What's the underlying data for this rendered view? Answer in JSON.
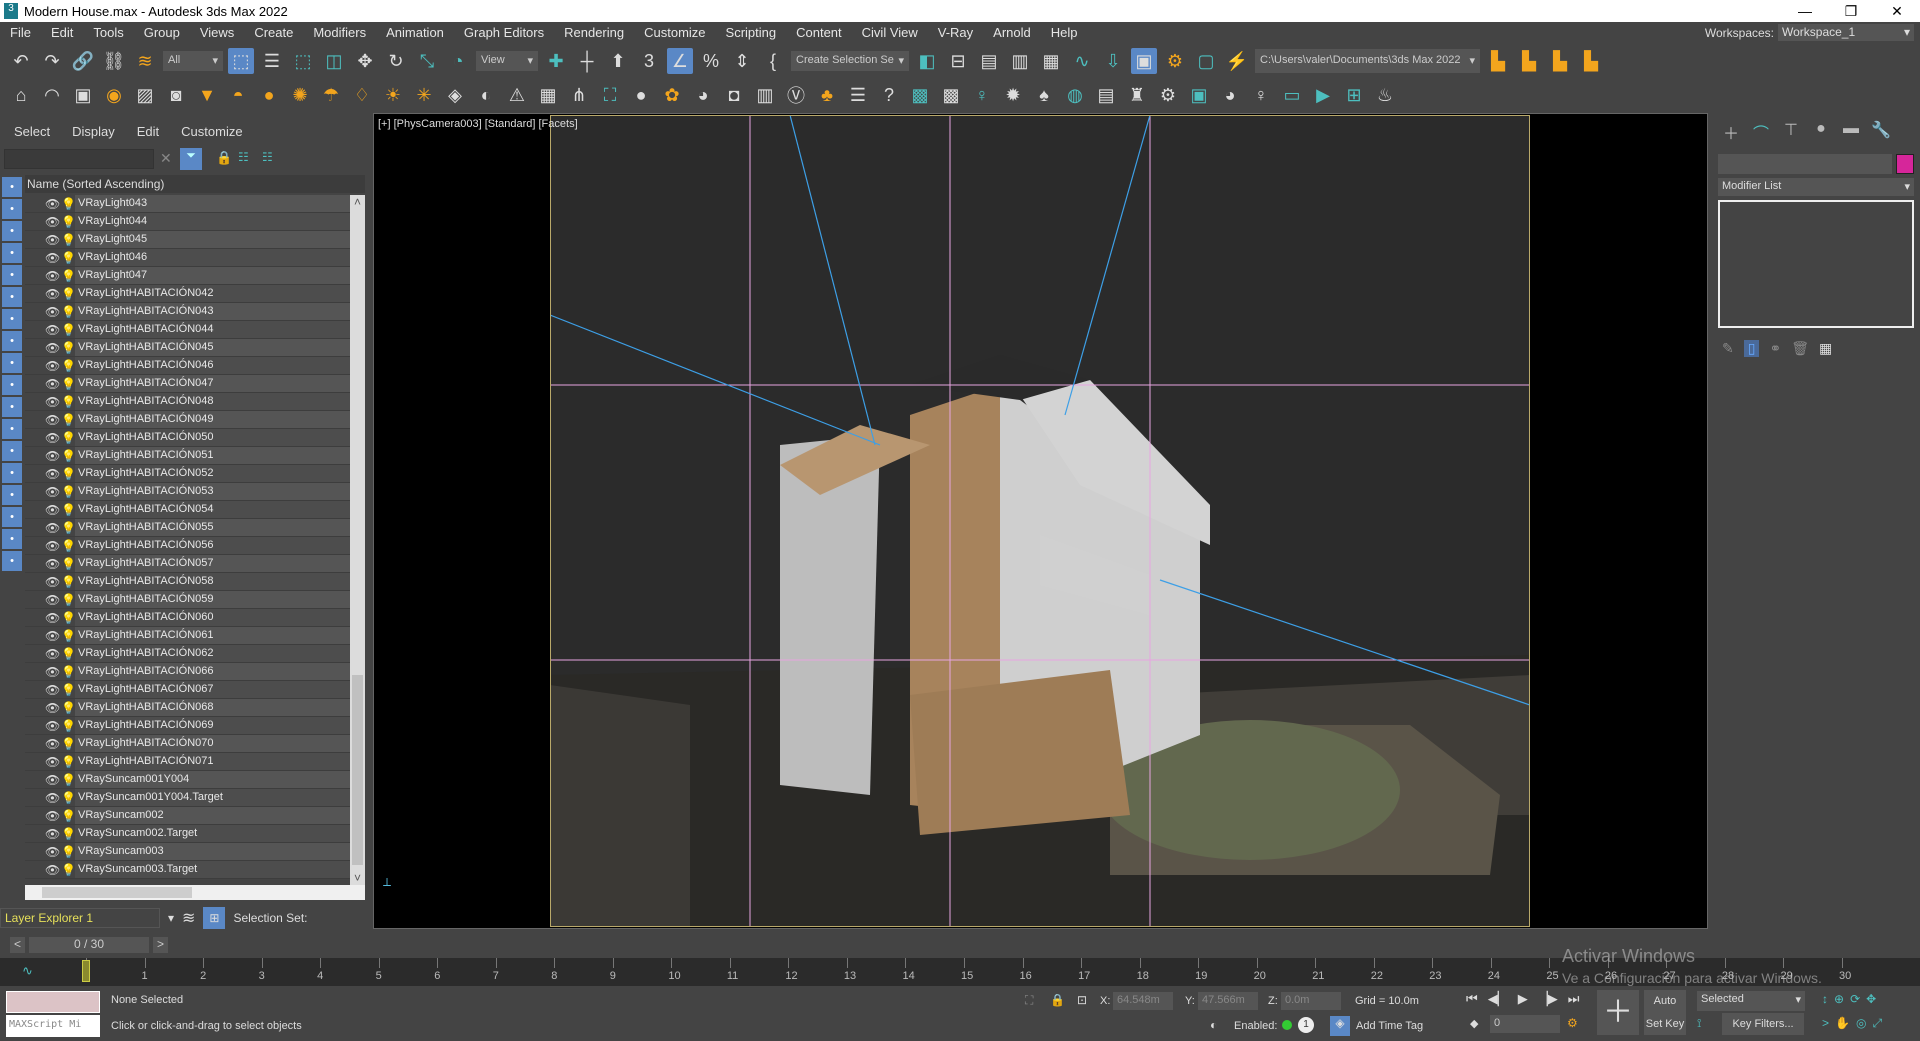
{
  "window": {
    "title": "Modern House.max - Autodesk 3ds Max 2022",
    "min": "—",
    "restore": "❐",
    "close": "✕"
  },
  "menu": [
    "File",
    "Edit",
    "Tools",
    "Group",
    "Views",
    "Create",
    "Modifiers",
    "Animation",
    "Graph Editors",
    "Rendering",
    "Customize",
    "Scripting",
    "Content",
    "Civil View",
    "V-Ray",
    "Arnold",
    "Help"
  ],
  "workspaces": {
    "label": "Workspaces:",
    "value": "Workspace_1"
  },
  "toolbar1": {
    "filter": "All",
    "refcoord": "View",
    "selset": "Create Selection Se",
    "path": "C:\\Users\\valer\\Documents\\3ds Max 2022",
    "icons_a": [
      [
        "undo-icon",
        "↶",
        ""
      ],
      [
        "redo-icon",
        "↷",
        ""
      ],
      [
        "link-icon",
        "🔗",
        ""
      ],
      [
        "unlink-icon",
        "⛓",
        ""
      ],
      [
        "bind-spacewarp-icon",
        "≋",
        "o"
      ]
    ],
    "icons_b": [
      [
        "select-object-icon",
        "⬚",
        "active"
      ],
      [
        "select-by-name-icon",
        "☰",
        ""
      ],
      [
        "rect-selection-icon",
        "⬚",
        "t"
      ],
      [
        "window-crossing-icon",
        "◫",
        "t"
      ],
      [
        "move-icon",
        "✥",
        ""
      ],
      [
        "rotate-icon",
        "↻",
        ""
      ],
      [
        "scale-icon",
        "⤡",
        "t"
      ],
      [
        "placement-icon",
        "◔",
        "t"
      ]
    ],
    "icons_c": [
      [
        "pivot-icon",
        "✚",
        "t"
      ],
      [
        "manipulate-icon",
        "┼",
        ""
      ],
      [
        "keyboard-shortcut-icon",
        "⬆",
        ""
      ],
      [
        "snaps-toggle-icon",
        "3",
        ""
      ],
      [
        "angle-snap-icon",
        "∠",
        "active"
      ],
      [
        "percent-snap-icon",
        "%",
        ""
      ],
      [
        "spinner-snap-icon",
        "⇕",
        ""
      ],
      [
        "edit-named-sel-icon",
        "{",
        ""
      ]
    ],
    "icons_d": [
      [
        "mirror-icon",
        "◧",
        "t"
      ],
      [
        "align-icon",
        "⊟",
        ""
      ],
      [
        "scene-explorer-icon",
        "▤",
        ""
      ],
      [
        "layer-explorer-icon",
        "▥",
        ""
      ],
      [
        "ribbon-icon",
        "▦",
        ""
      ],
      [
        "curve-editor-icon",
        "∿",
        "t"
      ],
      [
        "dope-sheet-icon",
        "⇩",
        "t"
      ],
      [
        "material-editor-icon",
        "▣",
        "active"
      ],
      [
        "render-setup-icon",
        "⚙",
        "o"
      ],
      [
        "rendered-frame-icon",
        "▢",
        "t"
      ],
      [
        "render-icon",
        "⚡",
        ""
      ]
    ],
    "icons_e": [
      [
        "project-folder-icon",
        "▙",
        "o"
      ],
      [
        "open-project-icon",
        "▙",
        "o"
      ],
      [
        "new-project-icon",
        "▙",
        "o"
      ],
      [
        "project-structure-icon",
        "▙",
        "o"
      ]
    ]
  },
  "toolbar2": [
    [
      "teapot-icon",
      "⌂",
      ""
    ],
    [
      "sphere-create-icon",
      "◠",
      ""
    ],
    [
      "box-create-icon",
      "▣",
      ""
    ],
    [
      "light-lister-icon",
      "◉",
      "o"
    ],
    [
      "camera-list-icon",
      "▨",
      ""
    ],
    [
      "physcamera-icon",
      "◙",
      ""
    ],
    [
      "spot-light-icon",
      "▼",
      "o"
    ],
    [
      "dome-light-icon",
      "◓",
      "o"
    ],
    [
      "sphere-light-icon",
      "●",
      "o"
    ],
    [
      "ies-light-icon",
      "✺",
      "o"
    ],
    [
      "lamp-icon",
      "☂",
      "o"
    ],
    [
      "omni-icon",
      "♢",
      "o"
    ],
    [
      "sun-icon",
      "☀",
      "o"
    ],
    [
      "ambient-light-icon",
      "✳",
      "o"
    ],
    [
      "vray-proxy-icon",
      "◈",
      ""
    ],
    [
      "vray-fur-icon",
      "◐",
      ""
    ],
    [
      "vray-plane-icon",
      "⚠",
      ""
    ],
    [
      "vray-instancer-icon",
      "▦",
      ""
    ],
    [
      "vray-grass-icon",
      "⋔",
      ""
    ],
    [
      "vray-fire-icon",
      "⛶",
      "t"
    ],
    [
      "vray-sphere-icon",
      "●",
      ""
    ],
    [
      "vray-material-icon",
      "✿",
      "o"
    ],
    [
      "vray-mtl-convert-icon",
      "◕",
      ""
    ],
    [
      "vray-mesh-export-icon",
      "◘",
      ""
    ],
    [
      "vray-scene-icon",
      "▥",
      ""
    ],
    [
      "vray-logo-icon",
      "Ⓥ",
      ""
    ],
    [
      "vray-trees-icon",
      "♣",
      "o"
    ],
    [
      "vray-log-icon",
      "☰",
      ""
    ],
    [
      "help-icon",
      "?",
      ""
    ],
    [
      "cam-1-icon",
      "▩",
      "t"
    ],
    [
      "cam-2-icon",
      "▩",
      ""
    ],
    [
      "vray-light-icon",
      "♀",
      "t"
    ],
    [
      "vray-sun-icon",
      "✹",
      ""
    ],
    [
      "vray-tree-icon",
      "♠",
      ""
    ],
    [
      "vray-dome-icon",
      "◍",
      "t"
    ],
    [
      "vray-info-icon",
      "▤",
      ""
    ],
    [
      "vray-fog-icon",
      "♜",
      ""
    ],
    [
      "vray-gear-icon",
      "⚙",
      ""
    ],
    [
      "vray-frame-icon",
      "▣",
      "t"
    ],
    [
      "vray-color-icon",
      "◕",
      ""
    ],
    [
      "vray-bulb-icon",
      "♀",
      ""
    ],
    [
      "vfb-icon",
      "▭",
      "t"
    ],
    [
      "vfb-play-icon",
      "▶",
      "t"
    ],
    [
      "safe-frame-icon",
      "⊞",
      "t"
    ],
    [
      "teapot-render-icon",
      "♨",
      ""
    ]
  ],
  "explorer": {
    "menu": [
      "Select",
      "Display",
      "Edit",
      "Customize"
    ],
    "search_placeholder": "",
    "column": "Name (Sorted Ascending)",
    "items": [
      "VRayLight043",
      "VRayLight044",
      "VRayLight045",
      "VRayLight046",
      "VRayLight047",
      "VRayLightHABITACIÓN042",
      "VRayLightHABITACIÓN043",
      "VRayLightHABITACIÓN044",
      "VRayLightHABITACIÓN045",
      "VRayLightHABITACIÓN046",
      "VRayLightHABITACIÓN047",
      "VRayLightHABITACIÓN048",
      "VRayLightHABITACIÓN049",
      "VRayLightHABITACIÓN050",
      "VRayLightHABITACIÓN051",
      "VRayLightHABITACIÓN052",
      "VRayLightHABITACIÓN053",
      "VRayLightHABITACIÓN054",
      "VRayLightHABITACIÓN055",
      "VRayLightHABITACIÓN056",
      "VRayLightHABITACIÓN057",
      "VRayLightHABITACIÓN058",
      "VRayLightHABITACIÓN059",
      "VRayLightHABITACIÓN060",
      "VRayLightHABITACIÓN061",
      "VRayLightHABITACIÓN062",
      "VRayLightHABITACIÓN066",
      "VRayLightHABITACIÓN067",
      "VRayLightHABITACIÓN068",
      "VRayLightHABITACIÓN069",
      "VRayLightHABITACIÓN070",
      "VRayLightHABITACIÓN071",
      "VRaySuncam001Y004",
      "VRaySuncam001Y004.Target",
      "VRaySuncam002",
      "VRaySuncam002.Target",
      "VRaySuncam003",
      "VRaySuncam003.Target"
    ],
    "layer": "Layer Explorer 1",
    "selection_set": "Selection Set:",
    "frames": "0 / 30"
  },
  "viewport": {
    "label": "[+] [PhysCamera003] [Standard] [Facets]"
  },
  "command": {
    "modifier_list": "Modifier List"
  },
  "timeline": {
    "start": 0,
    "end": 30,
    "current": 0
  },
  "status": {
    "selection": "None Selected",
    "prompt": "Click or click-and-drag to select objects",
    "maxscript": "MAXScript Mi",
    "x_label": "X:",
    "x": "64.548m",
    "y_label": "Y:",
    "y": "47.566m",
    "z_label": "Z:",
    "z": "0.0m",
    "grid": "Grid = 10.0m",
    "enabled": "Enabled:",
    "add_time_tag": "Add Time Tag",
    "auto_key": "Auto Key",
    "set_key": "Set Key",
    "key_mode": "Selected",
    "key_filters": "Key Filters...",
    "frame": "0",
    "watermark1": "Activar Windows",
    "watermark2": "Ve a Configuración para activar Windows."
  }
}
